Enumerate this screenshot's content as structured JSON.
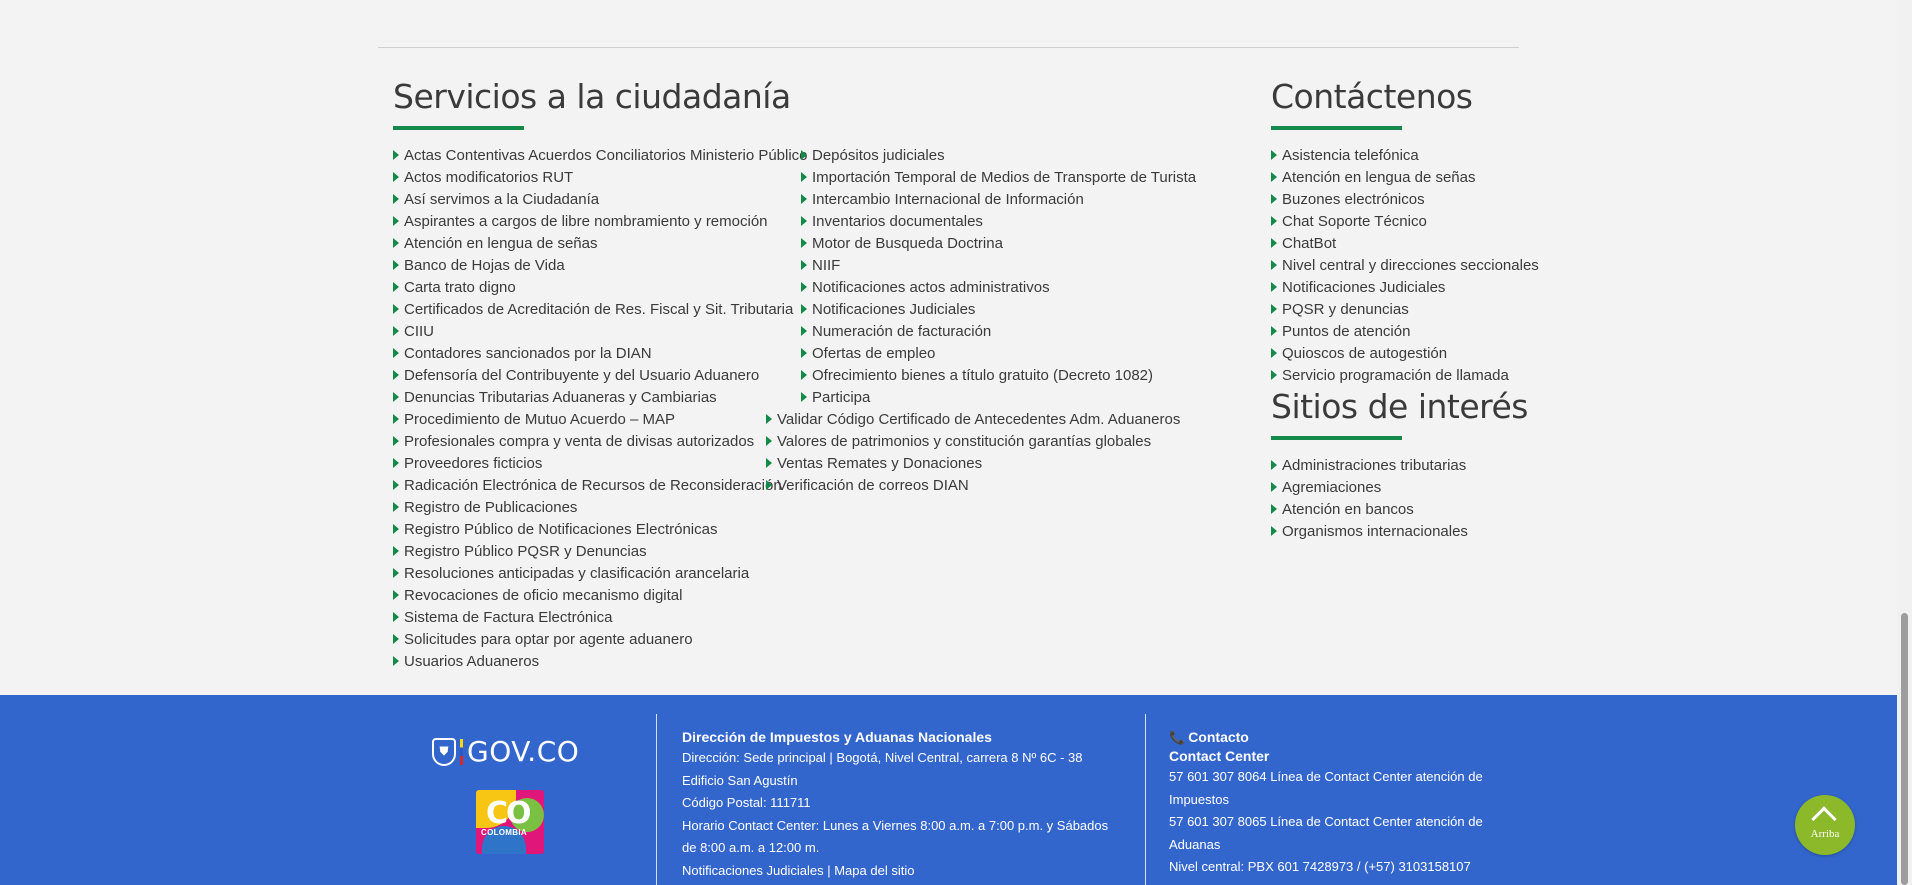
{
  "servicios": {
    "title": "Servicios a la ciudadanía",
    "col1": [
      "Actas Contentivas Acuerdos Conciliatorios Ministerio Público",
      "Actos modificatorios RUT",
      "Así servimos a la Ciudadanía",
      "Aspirantes a cargos de libre nombramiento y remoción",
      "Atención en lengua de señas",
      "Banco de Hojas de Vida",
      "Carta trato digno",
      "Certificados de Acreditación de Res. Fiscal y Sit. Tributaria",
      "CIIU",
      "Contadores sancionados por la DIAN",
      "Defensoría del Contribuyente y del Usuario Aduanero",
      "Denuncias Tributarias Aduaneras y Cambiarias",
      "Procedimiento de Mutuo Acuerdo – MAP",
      "Profesionales compra y venta de divisas autorizados",
      "Proveedores ficticios",
      "Radicación Electrónica de Recursos de Reconsideración",
      "Registro de Publicaciones",
      "Registro Público de Notificaciones Electrónicas",
      "Registro Público PQSR y Denuncias",
      "Resoluciones anticipadas y clasificación arancelaria",
      "Revocaciones de oficio mecanismo digital",
      "Sistema de Factura Electrónica",
      "Solicitudes para optar por agente aduanero",
      "Usuarios Aduaneros"
    ],
    "col2": [
      "Depósitos judiciales",
      "Importación Temporal de Medios de Transporte de Turista",
      "Intercambio Internacional de Información",
      "Inventarios documentales",
      "Motor de Busqueda Doctrina",
      "NIIF",
      "Notificaciones actos administrativos",
      "Notificaciones Judiciales",
      "Numeración de facturación",
      "Ofertas de empleo",
      "Ofrecimiento bienes a título gratuito (Decreto 1082)",
      "Participa"
    ],
    "col3": [
      "Validar Código Certificado de Antecedentes Adm. Aduaneros",
      "Valores de patrimonios y constitución garantías globales",
      "Ventas Remates y Donaciones",
      "Verificación de correos DIAN"
    ]
  },
  "contactenos": {
    "title": "Contáctenos",
    "items": [
      "Asistencia telefónica",
      "Atención en lengua de señas",
      "Buzones electrónicos",
      "Chat Soporte Técnico",
      "ChatBot",
      "Nivel central y direcciones seccionales",
      "Notificaciones Judiciales",
      "PQSR y denuncias",
      "Puntos de atención",
      "Quioscos de autogestión",
      "Servicio programación de llamada"
    ]
  },
  "sitios": {
    "title": "Sitios de interés",
    "items": [
      "Administraciones tributarias",
      "Agremiaciones",
      "Atención en bancos",
      "Organismos internacionales"
    ]
  },
  "footer": {
    "govco_text": "GOV.CO",
    "colombia_logo_text": "CO",
    "colombia_logo_word": "COLOMBIA",
    "entity": {
      "name": "Dirección de Impuestos y Aduanas Nacionales",
      "lines": [
        "Dirección: Sede principal | Bogotá, Nivel Central, carrera 8 Nº 6C - 38",
        "Edificio San Agustín",
        "Código Postal: 111711",
        "Horario Contact Center: Lunes a Viernes 8:00 a.m. a 7:00 p.m. y Sábados",
        "de 8:00 a.m. a 12:00 m.",
        "Notificaciones Judiciales | Mapa del sitio"
      ]
    },
    "contact": {
      "heading": "Contacto",
      "subheading": "Contact Center",
      "lines": [
        "57 601 307 8064 Línea de Contact Center atención de",
        "Impuestos",
        "57 601 307 8065 Línea de Contact Center atención de",
        "Aduanas",
        "Nivel central: PBX 601 7428973 / (+57) 3103158107"
      ]
    }
  },
  "arriba_label": "Arriba",
  "colors": {
    "accent_green": "#138a4a",
    "footer_blue": "#3366cc",
    "arriba_green": "#8bb92a"
  },
  "icons": {
    "list_bullet": "green-triangle-arrow-icon",
    "phone": "phone-icon",
    "arriba": "chevron-up-icon"
  }
}
